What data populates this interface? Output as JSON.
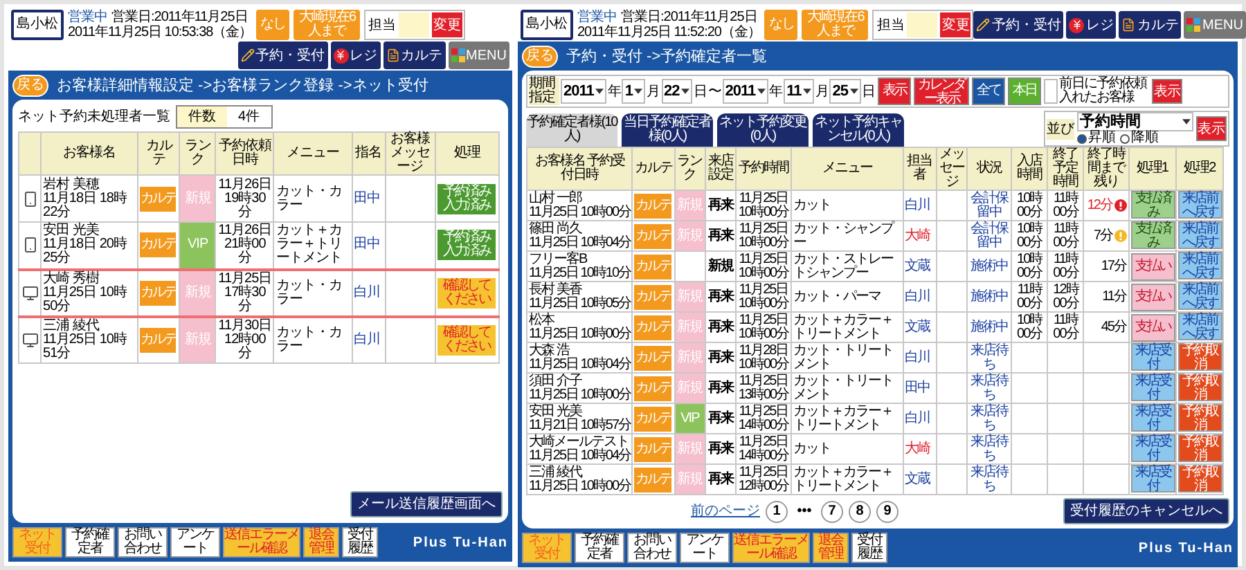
{
  "left": {
    "header": {
      "logo": "島小松",
      "status": "営業中",
      "business_day": "営業日:2011年11月25日",
      "datetime": "2011年11月25日 10:53:38（金）",
      "quick_buttons": [
        "なし",
        "大崎現在6人まで"
      ],
      "field_label": "担当",
      "field_button": "変更",
      "nav": [
        {
          "label": "予約・受付",
          "kind": "pen"
        },
        {
          "label": "レジ",
          "kind": "register"
        },
        {
          "label": "カルテ",
          "kind": "card"
        },
        {
          "label": "MENU",
          "kind": "menu"
        }
      ]
    },
    "back_button": "戻る",
    "breadcrumb": "お客様詳細情報設定 ->お客様ランク登録 ->ネット受付",
    "list_title": "ネット予約未処理者一覧",
    "count_label": "件数",
    "count_value": "4件",
    "columns": [
      "お客様名",
      "カルテ",
      "ランク",
      "予約依頼日時",
      "メニュー",
      "指名",
      "お客様メッセージ",
      "処理"
    ],
    "rows": [
      {
        "kind": "phone",
        "name": "岩村 美穂",
        "received": "11月18日 18時22分",
        "karte": "カルテ",
        "rank": {
          "label": "新規",
          "kind": "new"
        },
        "date": "11月26日",
        "time": "19時30分",
        "menu": "カット・カラー",
        "staff": "田中",
        "status": {
          "label": "予約済み入力済み",
          "kind": "done"
        },
        "highlighted": false
      },
      {
        "kind": "phone",
        "name": "安田 光美",
        "received": "11月18日 20時25分",
        "karte": "カルテ",
        "rank": {
          "label": "VIP",
          "kind": "vip"
        },
        "date": "11月26日",
        "time": "21時00分",
        "menu": "カット＋カラー＋トリートメント",
        "staff": "田中",
        "status": {
          "label": "予約済み入力済み",
          "kind": "done"
        },
        "highlighted": false
      },
      {
        "kind": "pc",
        "name": "大崎 秀樹",
        "received": "11月25日 10時50分",
        "karte": "カルテ",
        "rank": {
          "label": "新規",
          "kind": "new"
        },
        "date": "11月25日",
        "time": "17時30分",
        "menu": "カット・カラー",
        "staff": "白川",
        "status": {
          "label": "確認してください",
          "kind": "confirm"
        },
        "highlighted": true
      },
      {
        "kind": "pc",
        "name": "三浦 綾代",
        "received": "11月25日 10時51分",
        "karte": "カルテ",
        "rank": {
          "label": "新規",
          "kind": "new"
        },
        "date": "11月30日",
        "time": "12時00分",
        "menu": "カット・カラー",
        "staff": "白川",
        "status": {
          "label": "確認してください",
          "kind": "confirm"
        },
        "highlighted": false
      }
    ],
    "mail_button": "メール送信履歴画面へ",
    "footer": {
      "tabs": [
        {
          "label": "ネット受付",
          "kind": "accent"
        },
        {
          "label": "予約確定者",
          "kind": "plain"
        },
        {
          "label": "お問い合わせ",
          "kind": "plain"
        },
        {
          "label": "アンケート",
          "kind": "plain"
        },
        {
          "label": "送信エラーメール確認",
          "kind": "alert"
        },
        {
          "label": "退会管理",
          "kind": "alert"
        },
        {
          "label": "受付履歴",
          "kind": "plain"
        }
      ],
      "brand": "Plus Tu-Han"
    }
  },
  "right": {
    "header": {
      "logo": "島小松",
      "status": "営業中",
      "business_day": "営業日:2011年11月25日",
      "datetime": "2011年11月25日 11:52:20（金）",
      "quick_buttons": [
        "なし",
        "大崎現在6人まで"
      ],
      "field_label": "担当",
      "field_button": "変更",
      "nav": [
        {
          "label": "予約・受付",
          "kind": "pen"
        },
        {
          "label": "レジ",
          "kind": "register"
        },
        {
          "label": "カルテ",
          "kind": "card"
        },
        {
          "label": "MENU",
          "kind": "menu"
        }
      ]
    },
    "back_button": "戻る",
    "breadcrumb": "予約・受付 ->予約確定者一覧",
    "filter": {
      "label": "期間指定",
      "parts": [
        {
          "kind": "select",
          "value": "2011"
        },
        {
          "kind": "unit",
          "value": "年"
        },
        {
          "kind": "select",
          "value": "1"
        },
        {
          "kind": "unit",
          "value": "月"
        },
        {
          "kind": "select",
          "value": "22"
        },
        {
          "kind": "unit",
          "value": "日"
        },
        {
          "kind": "unit",
          "value": "〜"
        },
        {
          "kind": "select",
          "value": "2011"
        },
        {
          "kind": "unit",
          "value": "年"
        },
        {
          "kind": "select",
          "value": "11"
        },
        {
          "kind": "unit",
          "value": "月"
        },
        {
          "kind": "select",
          "value": "25"
        },
        {
          "kind": "unit",
          "value": "日"
        }
      ],
      "buttons": [
        {
          "label": "表示",
          "kind": "red"
        },
        {
          "label": "カレンダー表示",
          "kind": "red"
        },
        {
          "label": "全て",
          "kind": "blue"
        },
        {
          "label": "本日",
          "kind": "green"
        }
      ],
      "prev_day_label": "前日に予約依頼入れたお客様",
      "prev_day_button": "表示"
    },
    "sort": {
      "label": "並び",
      "value": "予約時間",
      "button": "表示",
      "options": [
        {
          "label": "昇順",
          "selected": true
        },
        {
          "label": "降順",
          "selected": false
        }
      ]
    },
    "tabs": [
      {
        "label": "予約確定者様(10人)",
        "selected": true
      },
      {
        "label": "当日予約確定者様(0人)",
        "selected": false
      },
      {
        "label": "ネット予約変更(0人)",
        "selected": false
      },
      {
        "label": "ネット予約キャンセル(0人)",
        "selected": false
      }
    ],
    "columns": [
      "お客様名 予約受付日時",
      "カルテ",
      "ランク",
      "来店設定",
      "予約時間",
      "メニュー",
      "担当者",
      "メッセージ",
      "状況",
      "入店時間",
      "終了予定時間",
      "終了時間まで残り",
      "処理1",
      "処理2"
    ],
    "rows": [
      {
        "name": "山村 一郎",
        "received": "11月25日 10時00分",
        "karte": "カルテ",
        "rank": {
          "label": "新規",
          "kind": "new"
        },
        "visit": "再来",
        "date": "11月25日",
        "time": "10時00分",
        "menu": "カット",
        "staff": "白川",
        "color": "#1a3fa0",
        "status": "会計保留中",
        "checkin": "10時00分",
        "end_plan": "11時00分",
        "remaining": "12分",
        "alert": {
          "kind": "red"
        },
        "actions": [
          {
            "label": "支払済み",
            "kind": "paid"
          },
          {
            "label": "来店前へ戻す",
            "kind": "back"
          }
        ]
      },
      {
        "name": "篠田 尚久",
        "received": "11月25日 10時04分",
        "karte": "カルテ",
        "rank": {
          "label": "新規",
          "kind": "new"
        },
        "visit": "再来",
        "date": "11月25日",
        "time": "10時00分",
        "menu": "カット・シャンプー",
        "staff": "大崎",
        "color": "#e0202a",
        "status": "会計保留中",
        "checkin": "10時00分",
        "end_plan": "11時00分",
        "remaining": "7分",
        "alert": {
          "kind": "yellow"
        },
        "actions": [
          {
            "label": "支払済み",
            "kind": "paid"
          },
          {
            "label": "来店前へ戻す",
            "kind": "back"
          }
        ]
      },
      {
        "name": "フリー客B",
        "received": "11月25日 10時10分",
        "karte": "カルテ",
        "visit": "新規",
        "date": "11月25日",
        "time": "10時00分",
        "menu": "カット・ストレートシャンプー",
        "staff": "文蔵",
        "color": "#1a3fa0",
        "status": "施術中",
        "checkin": "10時00分",
        "end_plan": "11時00分",
        "remaining": "17分",
        "actions": [
          {
            "label": "支払い",
            "kind": "pay"
          },
          {
            "label": "来店前へ戻す",
            "kind": "back"
          }
        ]
      },
      {
        "name": "長村 美香",
        "received": "11月25日 10時05分",
        "karte": "カルテ",
        "rank": {
          "label": "新規",
          "kind": "new"
        },
        "visit": "再来",
        "date": "11月25日",
        "time": "10時00分",
        "menu": "カット・パーマ",
        "staff": "白川",
        "color": "#1a3fa0",
        "status": "施術中",
        "checkin": "11時00分",
        "end_plan": "12時00分",
        "remaining": "11分",
        "actions": [
          {
            "label": "支払い",
            "kind": "pay"
          },
          {
            "label": "来店前へ戻す",
            "kind": "back"
          }
        ]
      },
      {
        "name": "松本",
        "received": "11月25日 10時00分",
        "karte": "カルテ",
        "rank": {
          "label": "新規",
          "kind": "new"
        },
        "visit": "再来",
        "date": "11月25日",
        "time": "10時00分",
        "menu": "カット＋カラー＋トリートメント",
        "staff": "文蔵",
        "color": "#1a3fa0",
        "status": "施術中",
        "checkin": "10時00分",
        "end_plan": "11時00分",
        "remaining": "45分",
        "actions": [
          {
            "label": "支払い",
            "kind": "pay"
          },
          {
            "label": "来店前へ戻す",
            "kind": "back"
          }
        ]
      },
      {
        "name": "大森 浩",
        "received": "11月25日 10時04分",
        "karte": "カルテ",
        "rank": {
          "label": "新規",
          "kind": "new"
        },
        "visit": "再来",
        "date": "11月28日",
        "time": "10時00分",
        "menu": "カット・トリートメント",
        "staff": "白川",
        "color": "#1a3fa0",
        "status": "来店待ち",
        "actions": [
          {
            "label": "来店受付",
            "kind": "checkin"
          },
          {
            "label": "予約取消",
            "kind": "cancel"
          }
        ]
      },
      {
        "name": "須田 介子",
        "received": "11月25日 10時00分",
        "karte": "カルテ",
        "rank": {
          "label": "新規",
          "kind": "new"
        },
        "visit": "再来",
        "date": "11月25日",
        "time": "13時00分",
        "menu": "カット・トリートメント",
        "staff": "田中",
        "color": "#1a3fa0",
        "status": "来店待ち",
        "actions": [
          {
            "label": "来店受付",
            "kind": "checkin"
          },
          {
            "label": "予約取消",
            "kind": "cancel"
          }
        ]
      },
      {
        "name": "安田 光美",
        "received": "11月21日 10時57分",
        "karte": "カルテ",
        "rank": {
          "label": "VIP",
          "kind": "vip"
        },
        "visit": "再来",
        "date": "11月25日",
        "time": "14時00分",
        "menu": "カット＋カラー＋トリートメント",
        "staff": "白川",
        "color": "#1a3fa0",
        "status": "来店待ち",
        "actions": [
          {
            "label": "来店受付",
            "kind": "checkin"
          },
          {
            "label": "予約取消",
            "kind": "cancel"
          }
        ]
      },
      {
        "name": "大崎メールテスト",
        "received": "11月25日 10時04分",
        "karte": "カルテ",
        "rank": {
          "label": "新規",
          "kind": "new"
        },
        "visit": "再来",
        "date": "11月25日",
        "time": "14時00分",
        "menu": "カット",
        "staff": "大崎",
        "color": "#e0202a",
        "status": "来店待ち",
        "actions": [
          {
            "label": "来店受付",
            "kind": "checkin"
          },
          {
            "label": "予約取消",
            "kind": "cancel"
          }
        ]
      },
      {
        "name": "三浦 綾代",
        "received": "11月25日 10時00分",
        "karte": "カルテ",
        "rank": {
          "label": "新規",
          "kind": "new"
        },
        "visit": "再来",
        "date": "11月25日",
        "time": "12時00分",
        "menu": "カット＋カラー＋トリートメント",
        "staff": "文蔵",
        "color": "#1a3fa0",
        "status": "来店待ち",
        "actions": [
          {
            "label": "来店受付",
            "kind": "checkin"
          },
          {
            "label": "予約取消",
            "kind": "cancel"
          }
        ]
      }
    ],
    "pagination": {
      "prev": "前のページ",
      "pages": [
        "1",
        "•••",
        "7",
        "8",
        "9"
      ]
    },
    "cancel_button": "受付履歴のキャンセルへ",
    "footer": {
      "tabs": [
        {
          "label": "ネット受付",
          "kind": "accent"
        },
        {
          "label": "予約確定者",
          "kind": "plain"
        },
        {
          "label": "お問い合わせ",
          "kind": "plain"
        },
        {
          "label": "アンケート",
          "kind": "plain"
        },
        {
          "label": "送信エラーメール確認",
          "kind": "alert"
        },
        {
          "label": "退会管理",
          "kind": "alert"
        },
        {
          "label": "受付履歴",
          "kind": "plain"
        }
      ],
      "brand": "Plus Tu-Han"
    }
  }
}
